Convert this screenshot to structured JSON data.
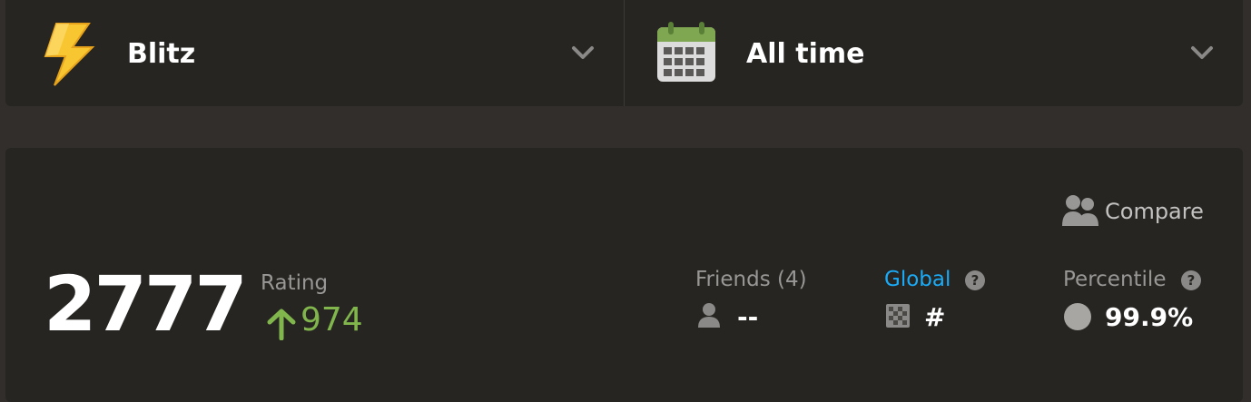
{
  "selectors": {
    "game_type": {
      "label": "Blitz",
      "icon": "lightning-icon",
      "accent": "#f7c631"
    },
    "time_range": {
      "label": "All time",
      "icon": "calendar-icon",
      "accent": "#7fa650"
    }
  },
  "stats": {
    "compare_label": "Compare",
    "rating_value": "2777",
    "rating_label": "Rating",
    "rating_change": "974",
    "rating_change_color": "#81b64c",
    "friends": {
      "label": "Friends (4)",
      "value": "--"
    },
    "global": {
      "label": "Global",
      "value": "#"
    },
    "percentile": {
      "label": "Percentile",
      "value": "99.9%"
    }
  }
}
